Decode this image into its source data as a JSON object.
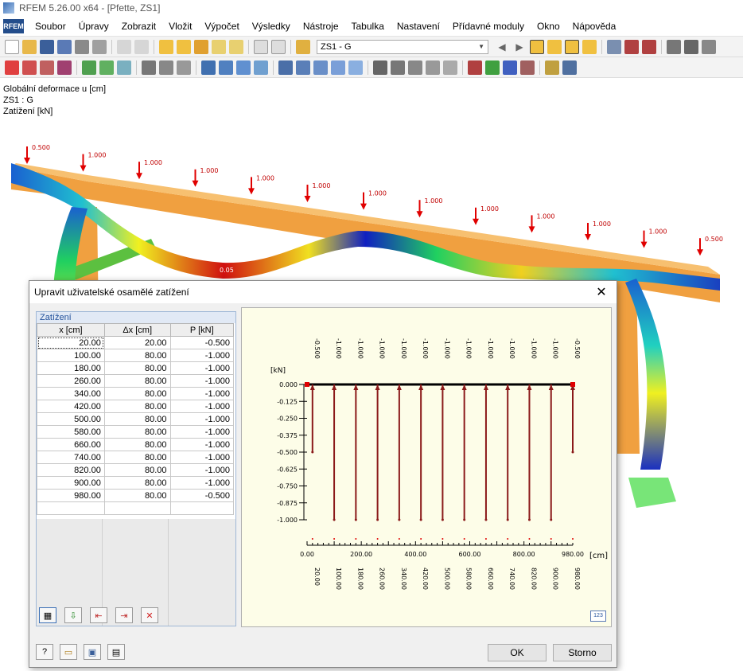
{
  "window": {
    "title": "RFEM 5.26.00 x64 - [Pfette, ZS1]"
  },
  "menu": {
    "logo_text": "RFEM",
    "items": [
      "Soubor",
      "Úpravy",
      "Zobrazit",
      "Vložit",
      "Výpočet",
      "Výsledky",
      "Nástroje",
      "Tabulka",
      "Nastavení",
      "Přídavné moduly",
      "Okno",
      "Nápověda"
    ]
  },
  "toolbar": {
    "loadcase": "ZS1 - G"
  },
  "info": {
    "line1": "Globální deformace u [cm]",
    "line2": "ZS1 : G",
    "line3": "Zatížení [kN]"
  },
  "model": {
    "load_labels": [
      "0.500",
      "1.000",
      "1.000",
      "1.000",
      "1.000",
      "1.000",
      "1.000",
      "1.000",
      "1.000",
      "1.000",
      "1.000",
      "1.000",
      "0.500"
    ],
    "deform_value": "0.05"
  },
  "dialog": {
    "title": "Upravit uživatelské osamělé zatížení",
    "panel_title": "Zatížení",
    "columns": [
      "x [cm]",
      "Δx [cm]",
      "P [kN]"
    ],
    "rows": [
      [
        "20.00",
        "20.00",
        "-0.500"
      ],
      [
        "100.00",
        "80.00",
        "-1.000"
      ],
      [
        "180.00",
        "80.00",
        "-1.000"
      ],
      [
        "260.00",
        "80.00",
        "-1.000"
      ],
      [
        "340.00",
        "80.00",
        "-1.000"
      ],
      [
        "420.00",
        "80.00",
        "-1.000"
      ],
      [
        "500.00",
        "80.00",
        "-1.000"
      ],
      [
        "580.00",
        "80.00",
        "-1.000"
      ],
      [
        "660.00",
        "80.00",
        "-1.000"
      ],
      [
        "740.00",
        "80.00",
        "-1.000"
      ],
      [
        "820.00",
        "80.00",
        "-1.000"
      ],
      [
        "900.00",
        "80.00",
        "-1.000"
      ],
      [
        "980.00",
        "80.00",
        "-0.500"
      ]
    ],
    "ok_label": "OK",
    "cancel_label": "Storno",
    "chart_icon_label": "123"
  },
  "chart_data": {
    "type": "bar",
    "x": [
      20,
      100,
      180,
      260,
      340,
      420,
      500,
      580,
      660,
      740,
      820,
      900,
      980
    ],
    "values": [
      -0.5,
      -1,
      -1,
      -1,
      -1,
      -1,
      -1,
      -1,
      -1,
      -1,
      -1,
      -1,
      -0.5
    ],
    "value_labels": [
      "-0.500",
      "-1.000",
      "-1.000",
      "-1.000",
      "-1.000",
      "-1.000",
      "-1.000",
      "-1.000",
      "-1.000",
      "-1.000",
      "-1.000",
      "-1.000",
      "-0.500"
    ],
    "x_labels": [
      "20.00",
      "100.00",
      "180.00",
      "260.00",
      "340.00",
      "420.00",
      "500.00",
      "580.00",
      "660.00",
      "740.00",
      "820.00",
      "900.00",
      "980.00"
    ],
    "ylabel": "[kN]",
    "xlabel": "[cm]",
    "xlim": [
      0,
      980
    ],
    "ylim": [
      -1,
      0
    ],
    "y_ticks": [
      "0.000",
      "-0.125",
      "-0.250",
      "-0.375",
      "-0.500",
      "-0.625",
      "-0.750",
      "-0.875",
      "-1.000"
    ],
    "x_ticks": [
      "0.00",
      "200.00",
      "400.00",
      "600.00",
      "800.00",
      "980.00"
    ],
    "x_tick_values": [
      0,
      200,
      400,
      600,
      800,
      980
    ],
    "colors": {
      "bar": "#8b1a1a",
      "axis": "#000000",
      "endpoint": "#e00000",
      "background": "#fdfde8"
    }
  }
}
